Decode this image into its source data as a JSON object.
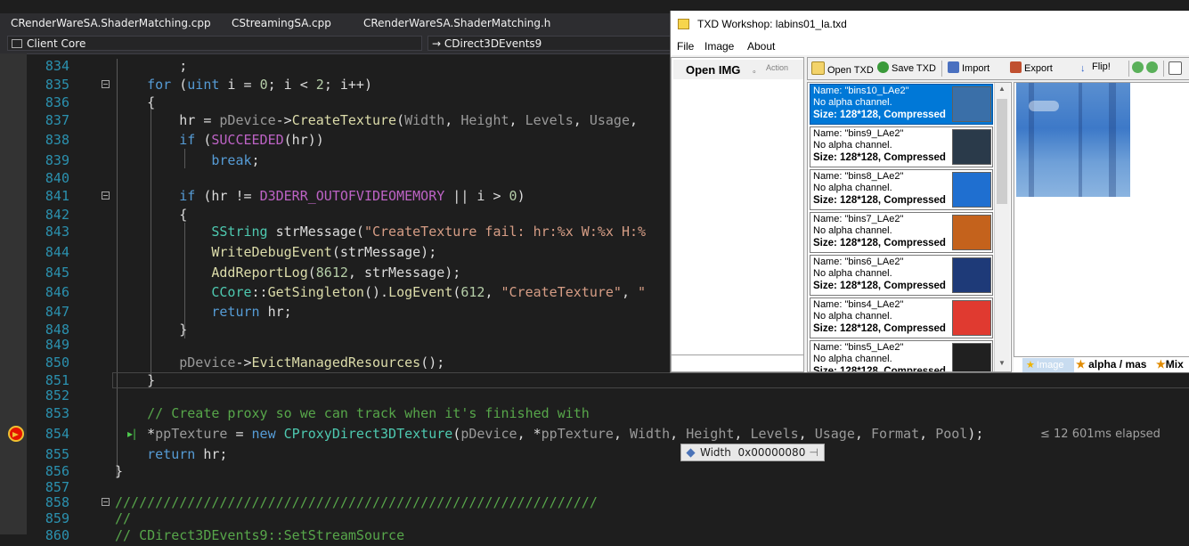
{
  "editor": {
    "tabs": [
      "CRenderWareSA.ShaderMatching.cpp",
      "CStreamingSA.cpp",
      "CRenderWareSA.ShaderMatching.h"
    ],
    "project_scope": "Client Core",
    "member_scope": "→ CDirect3DEvents9",
    "elapsed": "≤ 12 601ms elapsed",
    "datatip": {
      "name": "Width",
      "value": "0x00000080",
      "pin": "⊣"
    },
    "line_numbers": [
      "834",
      "835",
      "836",
      "837",
      "838",
      "839",
      "840",
      "841",
      "842",
      "843",
      "844",
      "845",
      "846",
      "847",
      "848",
      "849",
      "850",
      "851",
      "852",
      "853",
      "854",
      "855",
      "856",
      "857",
      "858",
      "859",
      "860"
    ]
  },
  "txd": {
    "title": "TXD Workshop: labins01_la.txd",
    "menu": [
      "File",
      "Image",
      "About"
    ],
    "open_img": "Open IMG",
    "action_label": "Action",
    "toolbar": [
      "Open TXD",
      "Save TXD",
      "Import",
      "Export",
      "Flip!"
    ],
    "entries": [
      {
        "name": "Name: \"bins10_LAe2\"",
        "alpha": "No alpha channel.",
        "size": "Size: 128*128, Compressed",
        "selected": true,
        "color": "#3a6fa8"
      },
      {
        "name": "Name: \"bins9_LAe2\"",
        "alpha": "No alpha channel.",
        "size": "Size: 128*128, Compressed",
        "selected": false,
        "color": "#2a3a4a"
      },
      {
        "name": "Name: \"bins8_LAe2\"",
        "alpha": "No alpha channel.",
        "size": "Size: 128*128, Compressed",
        "selected": false,
        "color": "#1f6fd0"
      },
      {
        "name": "Name: \"bins7_LAe2\"",
        "alpha": "No alpha channel.",
        "size": "Size: 128*128, Compressed",
        "selected": false,
        "color": "#c4621c"
      },
      {
        "name": "Name: \"bins6_LAe2\"",
        "alpha": "No alpha channel.",
        "size": "Size: 128*128, Compressed",
        "selected": false,
        "color": "#1e3a78"
      },
      {
        "name": "Name: \"bins4_LAe2\"",
        "alpha": "No alpha channel.",
        "size": "Size: 128*128, Compressed",
        "selected": false,
        "color": "#e03a30"
      },
      {
        "name": "Name: \"bins5_LAe2\"",
        "alpha": "No alpha channel.",
        "size": "Size: 128*128, Compressed",
        "selected": false,
        "color": "#202020"
      }
    ],
    "bottom_tabs": [
      "Image",
      "alpha / mas",
      "Mix"
    ]
  }
}
